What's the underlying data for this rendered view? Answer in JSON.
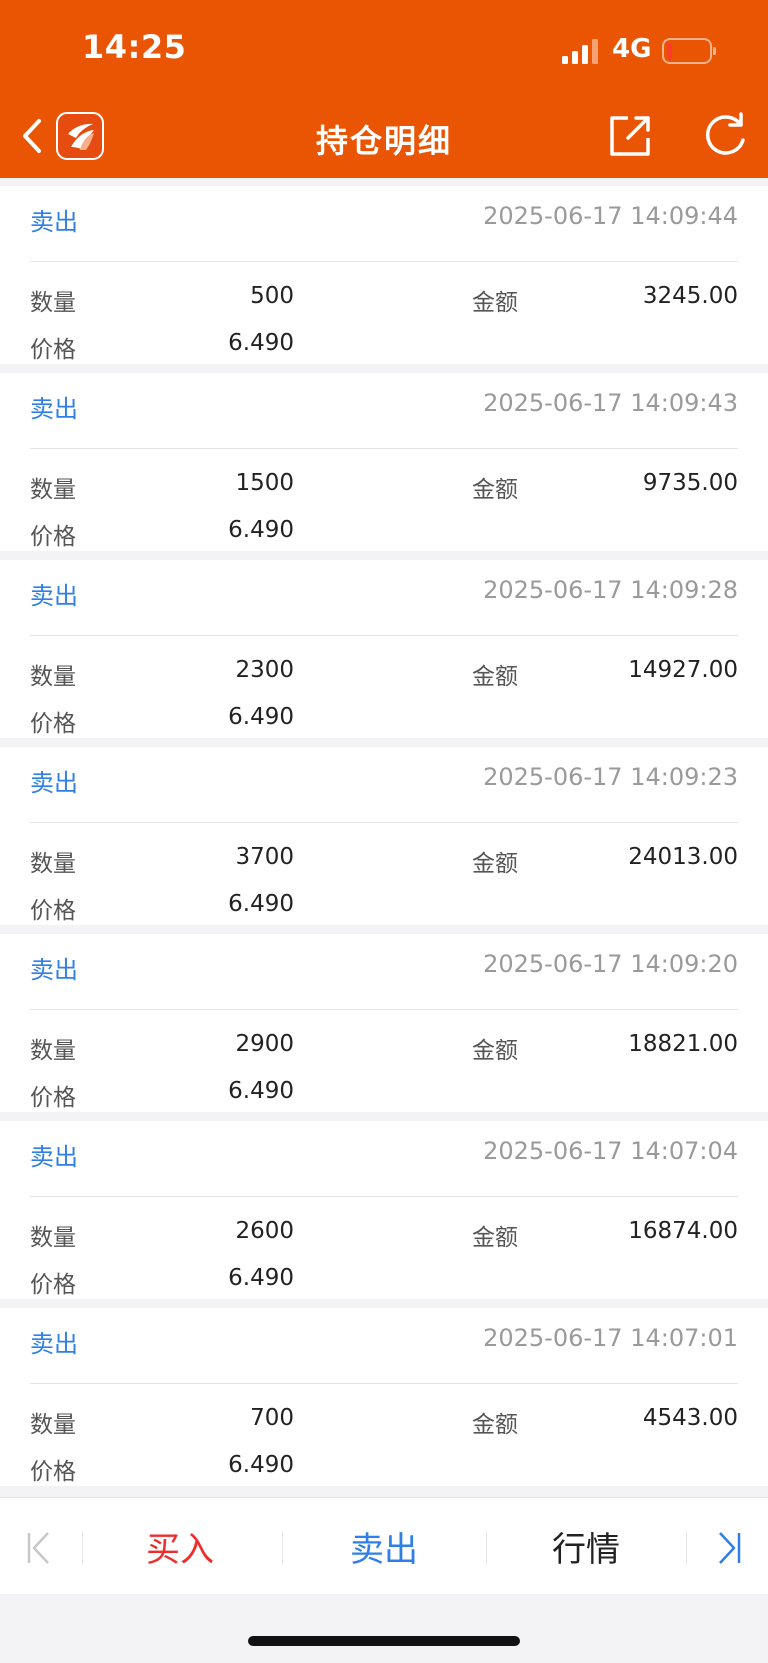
{
  "status_bar": {
    "time": "14:25",
    "network": "4G"
  },
  "header": {
    "title": "持仓明细"
  },
  "labels": {
    "quantity": "数量",
    "amount": "金额",
    "price": "价格"
  },
  "records": [
    {
      "type": "卖出",
      "time": "2025-06-17 14:09:44",
      "quantity": "500",
      "amount": "3245.00",
      "price": "6.490"
    },
    {
      "type": "卖出",
      "time": "2025-06-17 14:09:43",
      "quantity": "1500",
      "amount": "9735.00",
      "price": "6.490"
    },
    {
      "type": "卖出",
      "time": "2025-06-17 14:09:28",
      "quantity": "2300",
      "amount": "14927.00",
      "price": "6.490"
    },
    {
      "type": "卖出",
      "time": "2025-06-17 14:09:23",
      "quantity": "3700",
      "amount": "24013.00",
      "price": "6.490"
    },
    {
      "type": "卖出",
      "time": "2025-06-17 14:09:20",
      "quantity": "2900",
      "amount": "18821.00",
      "price": "6.490"
    },
    {
      "type": "卖出",
      "time": "2025-06-17 14:07:04",
      "quantity": "2600",
      "amount": "16874.00",
      "price": "6.490"
    },
    {
      "type": "卖出",
      "time": "2025-06-17 14:07:01",
      "quantity": "700",
      "amount": "4543.00",
      "price": "6.490"
    }
  ],
  "bottom_bar": {
    "buy": "买入",
    "sell": "卖出",
    "quote": "行情"
  },
  "colors": {
    "brand": "#ea5504",
    "sell": "#2f7fe6",
    "buy": "#ef2c2c"
  },
  "icons": [
    "back-icon",
    "app-logo-icon",
    "share-icon",
    "refresh-icon",
    "first-page-icon",
    "last-page-icon"
  ]
}
